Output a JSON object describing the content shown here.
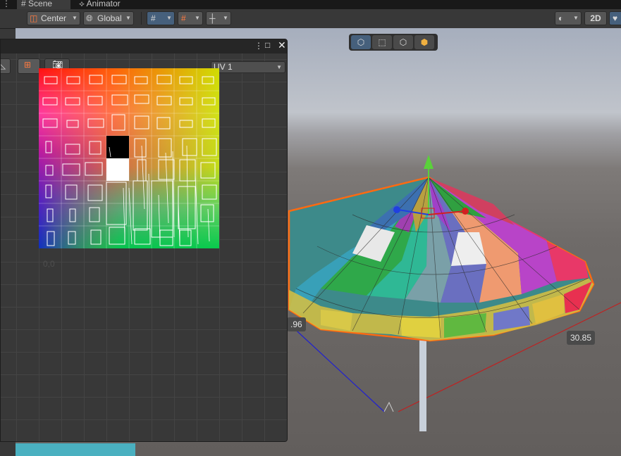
{
  "tabs": [
    {
      "label": "Scene",
      "icon": "hash-icon"
    },
    {
      "label": "Animator",
      "icon": "animator-icon"
    }
  ],
  "toolbar": {
    "pivot_label": "Center",
    "space_label": "Global",
    "mode_2d": "2D"
  },
  "uv_window": {
    "channel": "UV 1",
    "origin_label": "0,0"
  },
  "scene": {
    "dim_left": ".96",
    "dim_right": "30.85"
  },
  "colors": {
    "selection_outline": "#ff6a10",
    "gizmo_y": "#5ad13a",
    "gizmo_x": "#d22020",
    "gizmo_z": "#2040e0",
    "accent_active": "#46607c"
  }
}
